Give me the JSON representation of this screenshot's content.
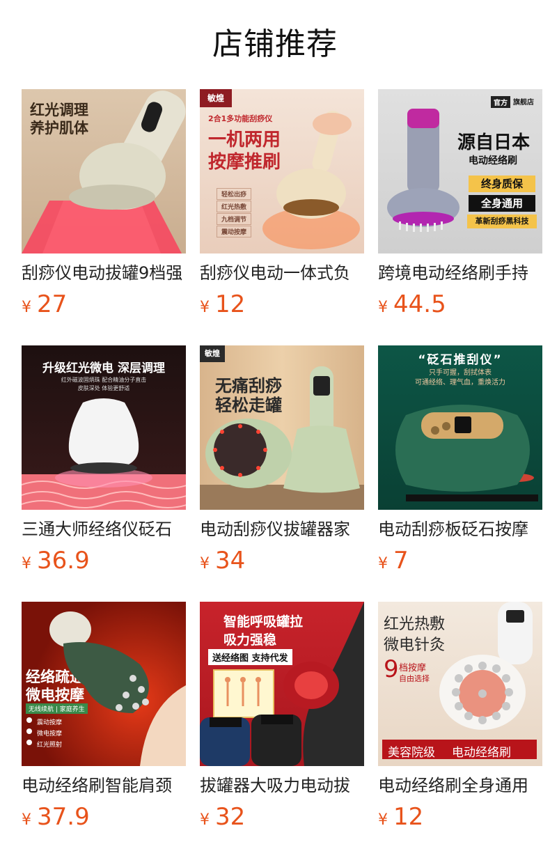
{
  "page_title": "店铺推荐",
  "currency_symbol": "¥",
  "products": [
    {
      "name": "刮痧仪电动拔罐9档强",
      "price": "27",
      "image_text": [
        "红光调理",
        "养护肌体"
      ],
      "colors": {
        "bg": "#d7c1a8",
        "accent": "#e8345a"
      }
    },
    {
      "name": "刮痧仪电动一体式负",
      "price": "12",
      "image_text": [
        "敏煌",
        "2合1多功能刮痧仪",
        "一机两用",
        "按摩推刷",
        "轻松出痧",
        "红光热敷",
        "九档调节",
        "震动按摩"
      ],
      "colors": {
        "bg": "#f1dfd2",
        "accent": "#c0272d"
      }
    },
    {
      "name": "跨境电动经络刷手持",
      "price": "44.5",
      "image_text": [
        "官方",
        "旗舰店",
        "源自日本",
        "电动经络刷",
        "终身质保",
        "全身通用",
        "革新刮痧黑科技"
      ],
      "colors": {
        "bg": "#dcdcdc",
        "accent": "#a020a0"
      }
    },
    {
      "name": "三通大师经络仪砭石",
      "price": "36.9",
      "image_text": [
        "升级红光微电 深层调理",
        "红外磁波固炳珠 配合精油分子直击",
        "皮肤深处 体验更舒适"
      ],
      "colors": {
        "bg": "#2a1616",
        "accent": "#f06a8a"
      }
    },
    {
      "name": "电动刮痧仪拔罐器家",
      "price": "34",
      "image_text": [
        "敏煌",
        "无痛刮痧",
        "轻松走罐"
      ],
      "colors": {
        "bg": "#e6c9a3",
        "accent": "#c4d6b3"
      }
    },
    {
      "name": "电动刮痧板砭石按摩",
      "price": "7",
      "image_text": [
        "“砭石推刮仪”",
        "只手可握，刮拭体表",
        "可通经络、理气血，重焕活力"
      ],
      "colors": {
        "bg": "#0f5a4a",
        "accent": "#e05050"
      }
    },
    {
      "name": "电动经络刷智能肩颈",
      "price": "37.9",
      "image_text": [
        "经络疏通",
        "微电按摩",
        "无线续航 | 家庭养生",
        "震动按摩",
        "微电按摩",
        "红光照射"
      ],
      "colors": {
        "bg": "#7a1208",
        "accent": "#f3e3c0"
      }
    },
    {
      "name": "拔罐器大吸力电动拔",
      "price": "32",
      "image_text": [
        "智能呼吸罐拉",
        "吸力强稳",
        "送经络图 支持代发"
      ],
      "colors": {
        "bg": "#c8232b",
        "accent": "#ffffff"
      }
    },
    {
      "name": "电动经络刷全身通用",
      "price": "12",
      "image_text": [
        "红光热敷",
        "微电针灸",
        "9",
        "档按摩",
        "自由选择",
        "美容院级",
        "电动经络刷"
      ],
      "colors": {
        "bg": "#f1e6da",
        "accent": "#b8141a"
      }
    }
  ]
}
